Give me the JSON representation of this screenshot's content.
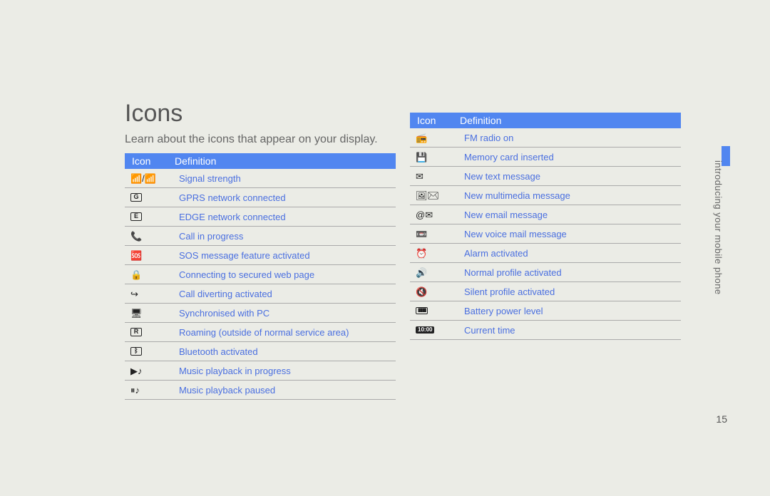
{
  "title": "Icons",
  "subtitle": "Learn about the icons that appear on your display.",
  "sidebar_text": "introducing your mobile phone",
  "page_number": "15",
  "header": {
    "icon": "Icon",
    "definition": "Definition"
  },
  "left_rows": [
    {
      "icon_label": "📶/📶",
      "def": "Signal strength"
    },
    {
      "icon_label": "G",
      "def": "GPRS network connected"
    },
    {
      "icon_label": "E",
      "def": "EDGE network connected"
    },
    {
      "icon_label": "📞",
      "def": "Call in progress"
    },
    {
      "icon_label": "🆘",
      "def": "SOS message feature activated"
    },
    {
      "icon_label": "🔒",
      "def": "Connecting to secured web page"
    },
    {
      "icon_label": "↪",
      "def": "Call diverting activated"
    },
    {
      "icon_label": "🖥",
      "def": "Synchronised with PC"
    },
    {
      "icon_label": "R",
      "def": "Roaming (outside of normal service area)"
    },
    {
      "icon_label": "ᛒ",
      "def": "Bluetooth activated"
    },
    {
      "icon_label": "▶♪",
      "def": "Music playback in progress"
    },
    {
      "icon_label": "⏸♪",
      "def": "Music playback paused"
    }
  ],
  "right_rows": [
    {
      "icon_label": "📻",
      "def": "FM radio on"
    },
    {
      "icon_label": "💾",
      "def": "Memory card inserted"
    },
    {
      "icon_label": "✉",
      "def": "New text message"
    },
    {
      "icon_label": "🖼✉",
      "def": "New multimedia message"
    },
    {
      "icon_label": "@✉",
      "def": "New email message"
    },
    {
      "icon_label": "📼",
      "def": "New voice mail message"
    },
    {
      "icon_label": "⏰",
      "def": "Alarm activated"
    },
    {
      "icon_label": "🔊",
      "def": "Normal profile activated"
    },
    {
      "icon_label": "🔇",
      "def": "Silent profile activated"
    },
    {
      "icon_label": "▮▮▮▮",
      "def": "Battery power level"
    },
    {
      "icon_label": "10:00",
      "def": "Current time"
    }
  ]
}
